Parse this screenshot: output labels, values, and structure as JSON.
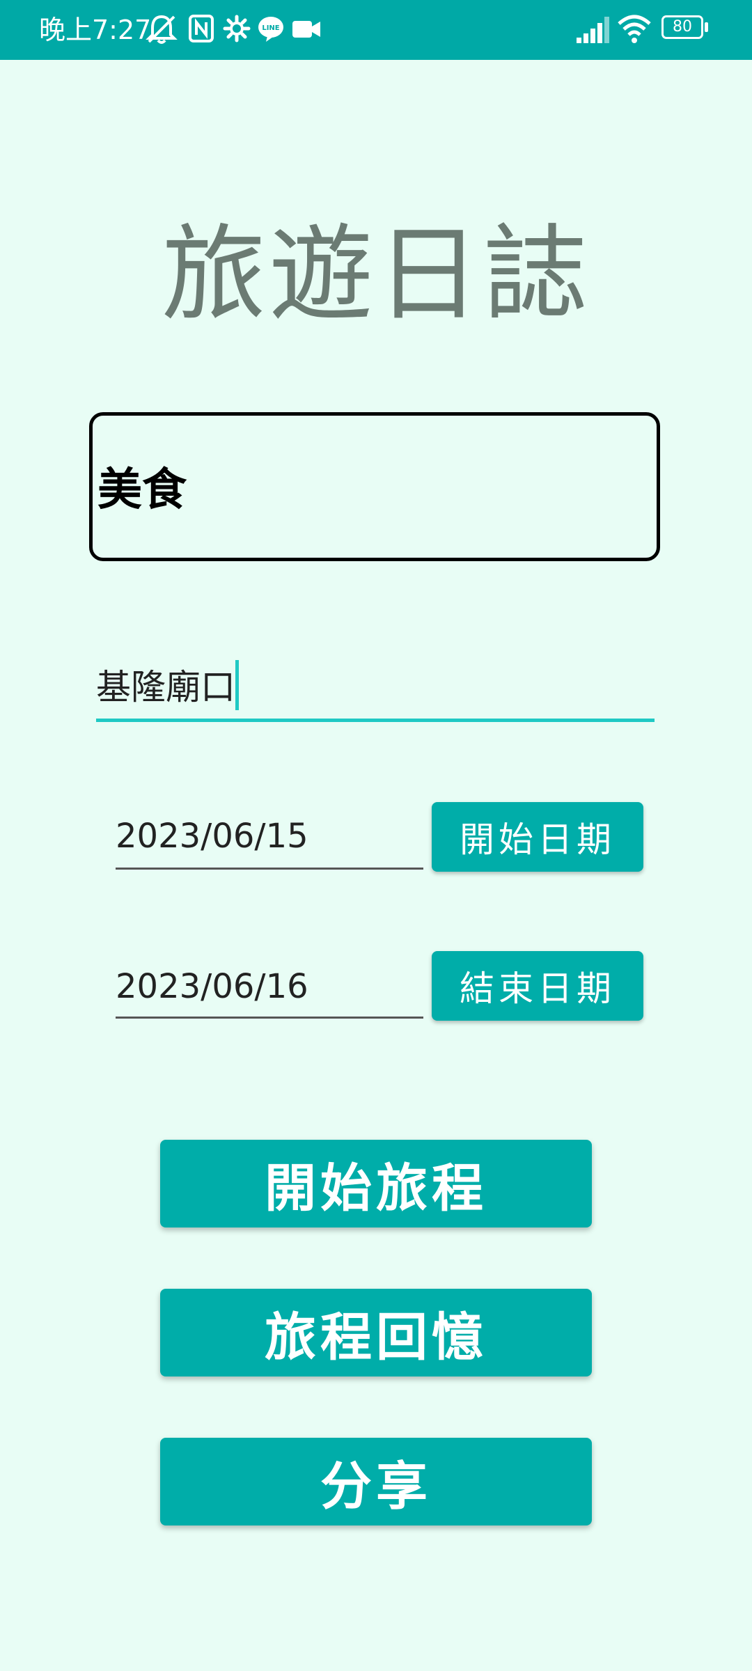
{
  "status_bar": {
    "time": "晚上7:27",
    "left_icons": [
      "bell-off-icon",
      "nfc-icon",
      "gear-icon",
      "line-app-icon",
      "video-camera-icon"
    ],
    "right_icons": [
      "signal-icon",
      "wifi-icon",
      "battery-icon"
    ],
    "battery_level": "80",
    "background_color": "#00A9A6"
  },
  "header": {
    "title": "旅遊日誌"
  },
  "form": {
    "category_value": "美食",
    "place_value": "基隆廟口",
    "start_date": "2023/06/15",
    "start_date_button": "開始日期",
    "end_date": "2023/06/16",
    "end_date_button": "結束日期"
  },
  "actions": {
    "start_trip": "開始旅程",
    "trip_memories": "旅程回憶",
    "share": "分享"
  },
  "colors": {
    "background": "#E8FDF5",
    "accent": "#00ADA9",
    "input_underline": "#1FC9C4",
    "title_text": "#6B7B73"
  }
}
